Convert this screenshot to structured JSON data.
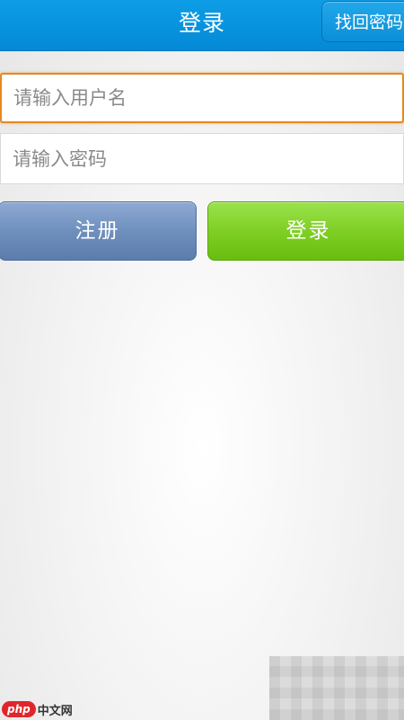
{
  "header": {
    "title": "登录",
    "recover_label": "找回密码"
  },
  "form": {
    "username_placeholder": "请输入用户名",
    "password_placeholder": "请输入密码",
    "register_label": "注册",
    "login_label": "登录"
  },
  "watermark": {
    "logo": "php",
    "text": "中文网"
  },
  "colors": {
    "header_bg": "#0a94e0",
    "focus_border": "#e6871f",
    "register_bg": "#6f8fbd",
    "login_bg": "#7fcf25"
  }
}
